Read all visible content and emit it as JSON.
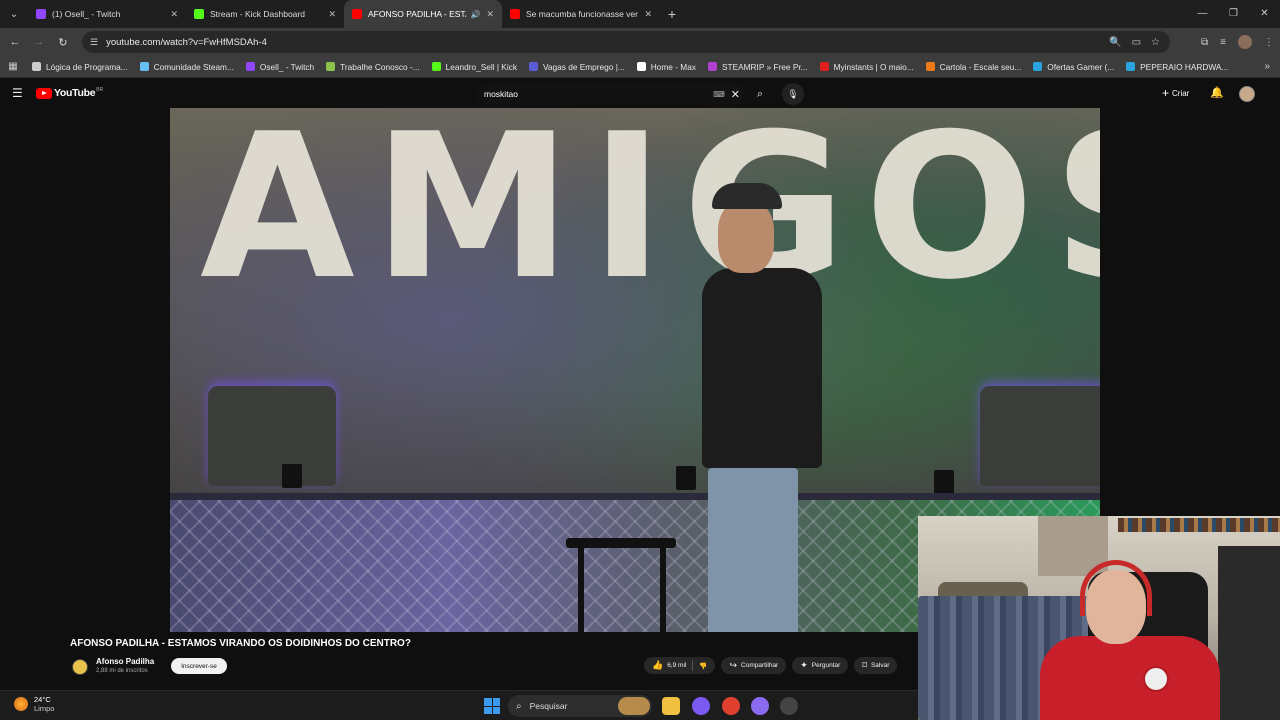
{
  "browser": {
    "tabs": [
      {
        "title": "(1) Osell_ - Twitch",
        "favicon_color": "#9146ff",
        "active": false
      },
      {
        "title": "Stream - Kick Dashboard",
        "favicon_color": "#53fc18",
        "active": false
      },
      {
        "title": "AFONSO PADILHA - ESTAM",
        "favicon_color": "#ff0000",
        "active": true
      },
      {
        "title": "Se macumba funcionasse versã",
        "favicon_color": "#ff0000",
        "active": false
      }
    ],
    "url": "youtube.com/watch?v=FwHfMSDAh-4",
    "bookmarks": [
      {
        "label": "Lógica de Programa...",
        "color": "#cccccc"
      },
      {
        "label": "Comunidade Steam...",
        "color": "#66c0f4"
      },
      {
        "label": "Osell_ - Twitch",
        "color": "#9146ff"
      },
      {
        "label": "Trabalhe Conosco -...",
        "color": "#8bc34a"
      },
      {
        "label": "Leandro_Sell | Kick",
        "color": "#53fc18"
      },
      {
        "label": "Vagas de Emprego |...",
        "color": "#5b5bd6"
      },
      {
        "label": "Home - Max",
        "color": "#ffffff"
      },
      {
        "label": "STEAMRIP » Free Pr...",
        "color": "#b040d0"
      },
      {
        "label": "Myinstants | O maio...",
        "color": "#e02020"
      },
      {
        "label": "Cartola - Escale seu...",
        "color": "#f07a1a"
      },
      {
        "label": "Ofertas Gamer (...",
        "color": "#2aa3e0"
      },
      {
        "label": "PEPERAIO HARDWA...",
        "color": "#2aa3e0"
      }
    ]
  },
  "youtube": {
    "logo_text": "YouTube",
    "country_code": "BR",
    "search_query": "moskitao",
    "create_label": "Criar",
    "video": {
      "title": "AFONSO PADILHA - ESTAMOS VIRANDO OS DOIDINHOS DO CENTRO?",
      "banner_text": "AMIGOS",
      "channel_name": "Afonso Padilha",
      "subscribers": "2,88 mi de inscritos",
      "subscribe_label": "Inscrever-se",
      "likes": "6,9 mil",
      "share_label": "Compartilhar",
      "ask_label": "Perguntar",
      "save_label": "Salvar"
    }
  },
  "taskbar": {
    "temperature": "24°C",
    "weather": "Limpo",
    "search_label": "Pesquisar"
  }
}
